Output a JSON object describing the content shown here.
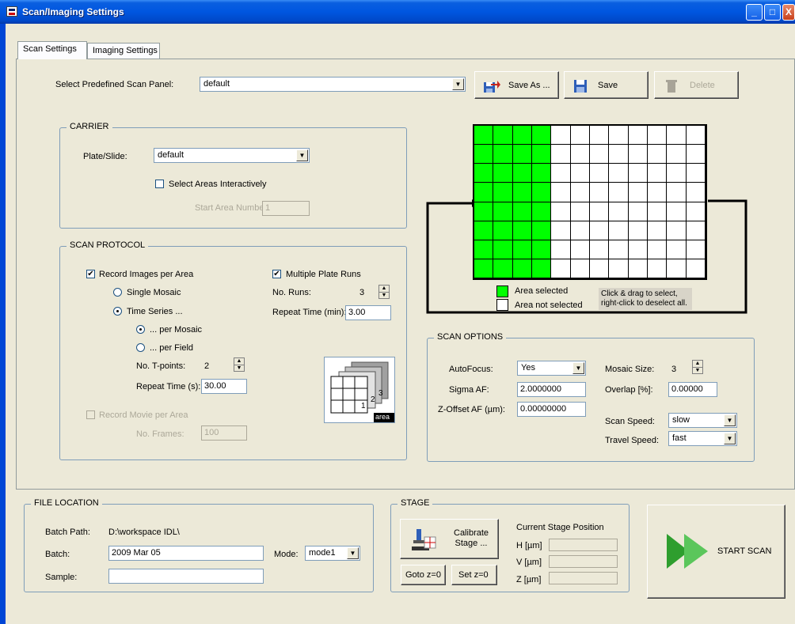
{
  "window": {
    "title": "Scan/Imaging Settings",
    "buttons": {
      "minimize": "_",
      "maximize": "□",
      "close": "X"
    }
  },
  "tabs": [
    {
      "label": "Scan Settings",
      "active": true
    },
    {
      "label": "Imaging Settings",
      "active": false
    }
  ],
  "scan_panel": {
    "label": "Select Predefined Scan Panel:",
    "value": "default",
    "save_as": "Save As ...",
    "save": "Save",
    "delete": "Delete"
  },
  "carrier": {
    "title": "CARRIER",
    "plate_label": "Plate/Slide:",
    "plate_value": "default",
    "select_interactive_label": "Select Areas Interactively",
    "select_interactive_checked": false,
    "start_area_label": "Start Area Number:",
    "start_area_value": "1"
  },
  "scan_protocol": {
    "title": "SCAN PROTOCOL",
    "record_images_label": "Record Images per Area",
    "record_images_checked": true,
    "single_mosaic_label": "Single Mosaic",
    "time_series_label": "Time Series ...",
    "per_mosaic_label": "... per Mosaic",
    "per_field_label": "... per Field",
    "tpoints_label": "No. T-points:",
    "tpoints_value": "2",
    "repeat_s_label": "Repeat Time (s):",
    "repeat_s_value": "30.00",
    "multiple_runs_label": "Multiple Plate Runs",
    "multiple_runs_checked": true,
    "runs_label": "No. Runs:",
    "runs_value": "3",
    "repeat_min_label": "Repeat Time (min):",
    "repeat_min_value": "3.00",
    "record_movie_label": "Record Movie per Area",
    "frames_label": "No. Frames:",
    "frames_value": "100",
    "stack_labels": {
      "n1": "1",
      "n2": "2",
      "n3": "3",
      "area": "area"
    }
  },
  "grid": {
    "columns": 12,
    "rows": 8,
    "selected_columns": 4,
    "selected_color": "#00FF00",
    "legend_selected": "Area selected",
    "legend_not_selected": "Area not selected",
    "hint_line1": "Click & drag to select,",
    "hint_line2": "right-click to deselect all."
  },
  "scan_options": {
    "title": "SCAN OPTIONS",
    "autofocus_label": "AutoFocus:",
    "autofocus_value": "Yes",
    "sigma_label": "Sigma AF:",
    "sigma_value": "2.0000000",
    "zoffset_label": "Z-Offset AF (µm):",
    "zoffset_value": "0.00000000",
    "mosaic_label": "Mosaic Size:",
    "mosaic_value": "3",
    "overlap_label": "Overlap [%]:",
    "overlap_value": "0.00000",
    "scan_speed_label": "Scan Speed:",
    "scan_speed_value": "slow",
    "travel_speed_label": "Travel Speed:",
    "travel_speed_value": "fast"
  },
  "file_location": {
    "title": "FILE LOCATION",
    "batch_path_label": "Batch Path:",
    "batch_path_value": "D:\\workspace IDL\\",
    "batch_label": "Batch:",
    "batch_value": "2009 Mar 05",
    "mode_label": "Mode:",
    "mode_value": "mode1",
    "sample_label": "Sample:",
    "sample_value": ""
  },
  "stage": {
    "title": "STAGE",
    "calibrate_line1": "Calibrate",
    "calibrate_line2": "Stage ...",
    "goto_z0": "Goto z=0",
    "set_z0": "Set z=0",
    "position_title": "Current Stage Position",
    "h_label": "H [µm]",
    "v_label": "V [µm]",
    "z_label": "Z [µm]"
  },
  "start_scan": {
    "label": "START SCAN",
    "arrow_color": "#2E9E2E"
  }
}
